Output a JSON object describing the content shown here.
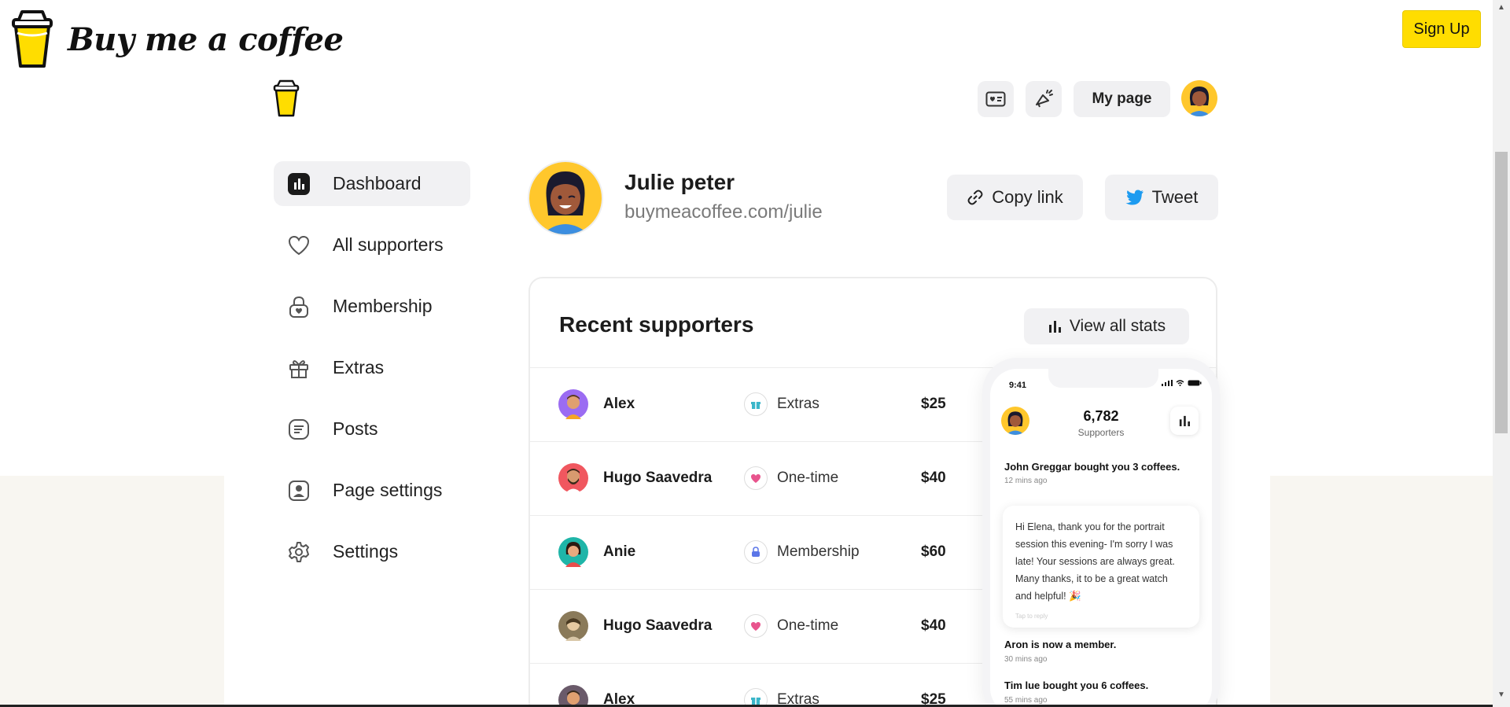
{
  "site": {
    "brand": "Buy me a coffee",
    "signup_label": "Sign Up",
    "colors": {
      "accent": "#ffdd00",
      "background_band": "#f8f6f1"
    }
  },
  "app_header": {
    "icons": [
      "id-card-icon",
      "megaphone-icon"
    ],
    "my_page_label": "My page"
  },
  "sidebar": {
    "items": [
      {
        "label": "Dashboard",
        "icon": "dashboard-icon",
        "active": true
      },
      {
        "label": "All supporters",
        "icon": "heart-icon"
      },
      {
        "label": "Membership",
        "icon": "lock-icon"
      },
      {
        "label": "Extras",
        "icon": "gift-icon"
      },
      {
        "label": "Posts",
        "icon": "posts-icon"
      },
      {
        "label": "Page settings",
        "icon": "page-settings-icon"
      },
      {
        "label": "Settings",
        "icon": "gear-icon"
      }
    ]
  },
  "profile": {
    "name": "Julie peter",
    "url": "buymeacoffee.com/julie",
    "copy_link_label": "Copy link",
    "tweet_label": "Tweet"
  },
  "supporters": {
    "title": "Recent supporters",
    "view_stats_label": "View all stats",
    "rows": [
      {
        "name": "Alex",
        "type": "Extras",
        "amount": "$25",
        "type_color": "#3bb6c9"
      },
      {
        "name": "Hugo Saavedra",
        "type": "One-time",
        "amount": "$40",
        "type_color": "#e8548d"
      },
      {
        "name": "Anie",
        "type": "Membership",
        "amount": "$60",
        "type_color": "#5b76e8"
      },
      {
        "name": "Hugo Saavedra",
        "type": "One-time",
        "amount": "$40",
        "type_color": "#e8548d"
      },
      {
        "name": "Alex",
        "type": "Extras",
        "amount": "$25",
        "type_color": "#3bb6c9"
      }
    ]
  },
  "phone": {
    "time": "9:41",
    "count": "6,782",
    "count_label": "Supporters",
    "feed": [
      {
        "title": "John Greggar bought you 3 coffees.",
        "time": "12 mins ago"
      },
      {
        "title": "Aron is now a member.",
        "time": "30 mins ago"
      },
      {
        "title": "Tim lue bought you 6 coffees.",
        "time": "55 mins ago"
      }
    ],
    "message": "Hi Elena, thank you for the portrait session this evening- I'm sorry I was late! Your sessions are always great. Many thanks, it to be a great watch and helpful! 🎉",
    "tap_to_reply": "Tap to reply"
  }
}
